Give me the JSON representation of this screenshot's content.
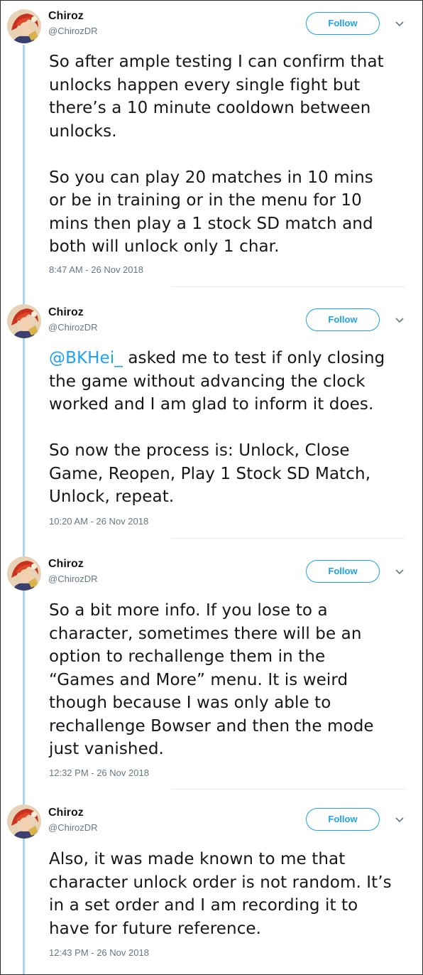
{
  "tweets": [
    {
      "name": "Chiroz",
      "handle": "@ChirozDR",
      "follow_label": "Follow",
      "lines": [
        "So after ample testing I can confirm that",
        "unlocks happen every single fight but",
        "there’s a 10 minute cooldown between",
        "unlocks.",
        "",
        "So you can play 20 matches in 10 mins",
        "or be in training or in the menu for 10",
        "mins then play a 1 stock SD match and",
        "both will unlock only 1 char."
      ],
      "timestamp": "8:47 AM - 26 Nov 2018"
    },
    {
      "name": "Chiroz",
      "handle": "@ChirozDR",
      "follow_label": "Follow",
      "mention": "@BKHei_",
      "lines": [
        " asked me to test if only closing",
        "the game without advancing the clock",
        "worked and I am glad to inform it does.",
        "",
        "So now the process is: Unlock, Close",
        "Game, Reopen, Play 1 Stock SD Match,",
        "Unlock, repeat."
      ],
      "timestamp": "10:20 AM - 26 Nov 2018"
    },
    {
      "name": "Chiroz",
      "handle": "@ChirozDR",
      "follow_label": "Follow",
      "lines": [
        "So a bit more info. If you lose to a",
        "character, sometimes there will be an",
        "option to rechallenge them in the",
        "“Games and More” menu. It is weird",
        "though because I was only able to",
        "rechallenge Bowser and then the mode",
        "just vanished."
      ],
      "timestamp": "12:32 PM - 26 Nov 2018"
    },
    {
      "name": "Chiroz",
      "handle": "@ChirozDR",
      "follow_label": "Follow",
      "lines": [
        "Also, it was made known to me that",
        "character unlock order is not random. It’s",
        "in a set order and I am recording it to",
        "have for future reference."
      ],
      "timestamp": "12:43 PM - 26 Nov 2018"
    }
  ],
  "icons": {
    "more": "chevron-down-icon",
    "avatar": "avatar"
  },
  "colors": {
    "accent": "#1da1f2",
    "thread_line": "#a9d5ee",
    "muted": "#657786",
    "text": "#14171a"
  }
}
